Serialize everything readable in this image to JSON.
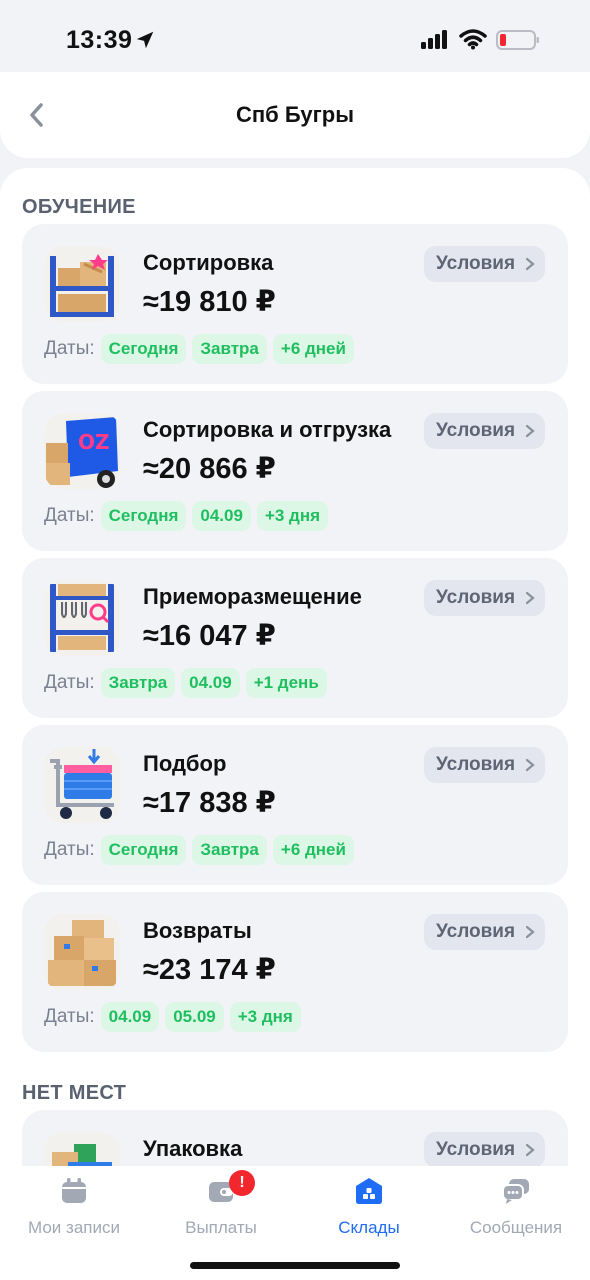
{
  "status_bar": {
    "time": "13:39"
  },
  "header": {
    "title": "Спб Бугры"
  },
  "sections": {
    "training": "ОБУЧЕНИЕ",
    "no_places": "НЕТ МЕСТ"
  },
  "cards": [
    {
      "name": "Сортировка",
      "price": "≈19 810 ₽",
      "conditions": "Условия",
      "dates_label": "Даты:",
      "dates": [
        "Сегодня",
        "Завтра",
        "+6 дней"
      ],
      "icon": "shelf-boxes-icon"
    },
    {
      "name": "Сортировка и отгрузка",
      "price": "≈20 866 ₽",
      "conditions": "Условия",
      "dates_label": "Даты:",
      "dates": [
        "Сегодня",
        "04.09",
        "+3 дня"
      ],
      "icon": "ozon-truck-icon"
    },
    {
      "name": "Приеморазмещение",
      "price": "≈16 047 ₽",
      "conditions": "Условия",
      "dates_label": "Даты:",
      "dates": [
        "Завтра",
        "04.09",
        "+1 день"
      ],
      "icon": "shelf-glasses-icon"
    },
    {
      "name": "Подбор",
      "price": "≈17 838 ₽",
      "conditions": "Условия",
      "dates_label": "Даты:",
      "dates": [
        "Сегодня",
        "Завтра",
        "+6 дней"
      ],
      "icon": "cart-icon"
    },
    {
      "name": "Возвраты",
      "price": "≈23 174 ₽",
      "conditions": "Условия",
      "dates_label": "Даты:",
      "dates": [
        "04.09",
        "05.09",
        "+3 дня"
      ],
      "icon": "boxes-stack-icon"
    },
    {
      "name": "Упаковка",
      "conditions": "Условия",
      "icon": "packing-icon"
    }
  ],
  "tabbar": {
    "items": [
      {
        "label": "Мои записи",
        "icon": "calendar-icon"
      },
      {
        "label": "Выплаты",
        "icon": "wallet-icon",
        "badge": "!"
      },
      {
        "label": "Склады",
        "icon": "warehouse-icon",
        "active": true
      },
      {
        "label": "Сообщения",
        "icon": "chat-icon"
      }
    ]
  },
  "colors": {
    "accent": "#1f6cf5",
    "chip_text": "#1fbf5f",
    "chip_bg": "#dcf7e6",
    "badge": "#f2272e"
  }
}
